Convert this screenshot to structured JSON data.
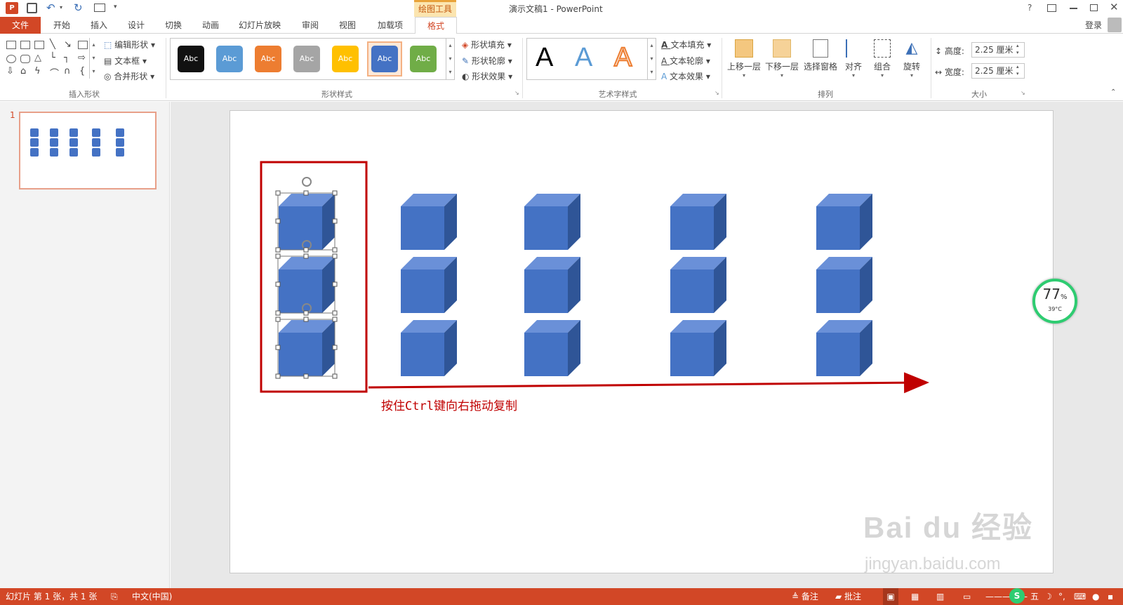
{
  "window": {
    "title": "演示文稿1 - PowerPoint",
    "context_tab": "绘图工具",
    "help": "?",
    "login": "登录"
  },
  "tabs": [
    {
      "label": "文件"
    },
    {
      "label": "开始"
    },
    {
      "label": "插入"
    },
    {
      "label": "设计"
    },
    {
      "label": "切换"
    },
    {
      "label": "动画"
    },
    {
      "label": "幻灯片放映"
    },
    {
      "label": "审阅"
    },
    {
      "label": "视图"
    },
    {
      "label": "加载项"
    },
    {
      "label": "格式"
    }
  ],
  "ribbon": {
    "insert_shapes": {
      "edit_shape": "编辑形状",
      "text_box": "文本框",
      "merge_shapes": "合并形状",
      "label": "插入形状"
    },
    "shape_styles": {
      "swatches": [
        {
          "text": "Abc",
          "color": "#000000"
        },
        {
          "text": "Abc",
          "color": "#5b9bd5"
        },
        {
          "text": "Abc",
          "color": "#ed7d31"
        },
        {
          "text": "Abc",
          "color": "#a5a5a5"
        },
        {
          "text": "Abc",
          "color": "#ffc000"
        },
        {
          "text": "Abc",
          "color": "#4472c4"
        },
        {
          "text": "Abc",
          "color": "#70ad47"
        }
      ],
      "fill": "形状填充",
      "outline": "形状轮廓",
      "effects": "形状效果",
      "label": "形状样式"
    },
    "wordart": {
      "letters": [
        "A",
        "A",
        "A"
      ],
      "text_fill": "文本填充",
      "text_outline": "文本轮廓",
      "text_effects": "文本效果",
      "label": "艺术字样式"
    },
    "arrange": {
      "bring_forward": "上移一层",
      "send_backward": "下移一层",
      "selection_pane": "选择窗格",
      "align": "对齐",
      "group": "组合",
      "rotate": "旋转",
      "label": "排列"
    },
    "size": {
      "height_label": "高度:",
      "height_value": "2.25 厘米",
      "width_label": "宽度:",
      "width_value": "2.25 厘米",
      "label": "大小"
    }
  },
  "thumbnail": {
    "number": "1"
  },
  "slide": {
    "annotation": "按住Ctrl键向右拖动复制"
  },
  "overlay": {
    "percent": "77",
    "percent_sign": "%",
    "temp": "39°C"
  },
  "watermark": {
    "brand": "Bai du 经验",
    "url": "jingyan.baidu.com"
  },
  "status": {
    "slide_info": "幻灯片 第 1 张，共 1 张",
    "language": "中文(中国)",
    "notes": "备注",
    "comments": "批注",
    "ime": "五"
  },
  "colors": {
    "accent": "#d24726",
    "cube_front": "#4472c4",
    "annotation": "#c00000"
  }
}
